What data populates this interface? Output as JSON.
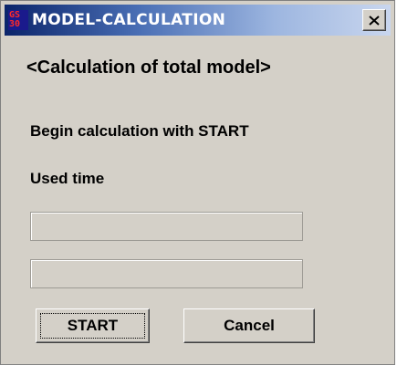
{
  "window": {
    "title": "MODEL-CALCULATION",
    "app_icon_text_top": "GS",
    "app_icon_text_bottom": "30",
    "close_glyph": "close-icon"
  },
  "dialog": {
    "heading": "<Calculation of total model>",
    "instruction": "Begin calculation with START",
    "used_time_label": "Used time",
    "field_1_value": "",
    "field_2_value": ""
  },
  "buttons": {
    "start_label": "START",
    "cancel_label": "Cancel"
  },
  "colors": {
    "titlebar_start": "#0a246a",
    "titlebar_end": "#c9d6ee",
    "face": "#d4d0c8",
    "icon_accent": "#ff2a2a"
  }
}
